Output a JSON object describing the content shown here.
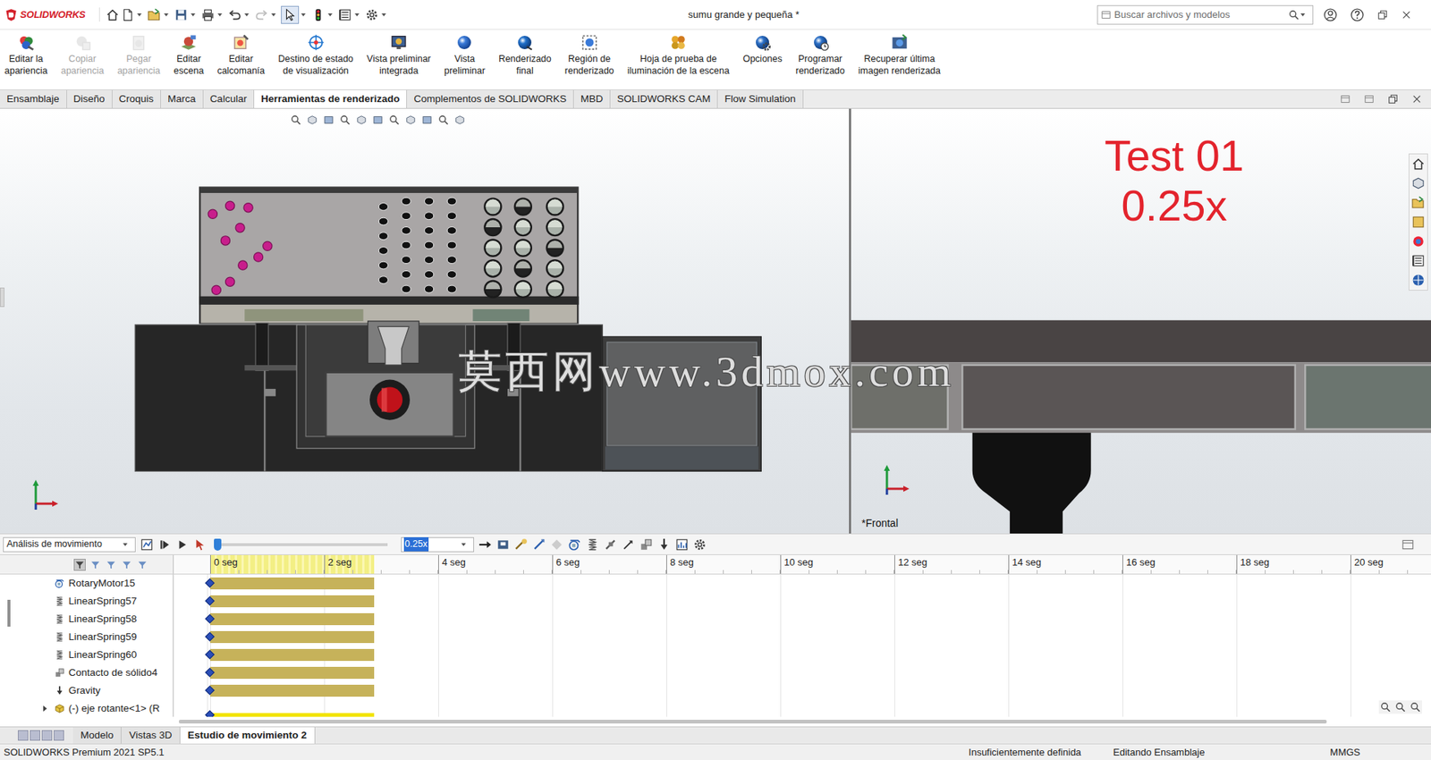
{
  "window": {
    "logo": "SOLIDWORKS",
    "title": "sumu grande y pequeña *",
    "select_tool_active": true
  },
  "search": {
    "placeholder": "Buscar archivos y modelos"
  },
  "ribbon": [
    {
      "lines": [
        "Editar la",
        "apariencia"
      ],
      "disabled": false
    },
    {
      "lines": [
        "Copiar",
        "apariencia"
      ],
      "disabled": true
    },
    {
      "lines": [
        "Pegar",
        "apariencia"
      ],
      "disabled": true
    },
    {
      "lines": [
        "Editar",
        "escena"
      ],
      "disabled": false
    },
    {
      "lines": [
        "Editar",
        "calcomanía"
      ],
      "disabled": false
    },
    {
      "lines": [
        "Destino de estado",
        "de visualización"
      ],
      "disabled": false
    },
    {
      "lines": [
        "Vista preliminar",
        "integrada"
      ],
      "disabled": false
    },
    {
      "lines": [
        "Vista",
        "preliminar"
      ],
      "disabled": false
    },
    {
      "lines": [
        "Renderizado",
        "final"
      ],
      "disabled": false
    },
    {
      "lines": [
        "Región de",
        "renderizado"
      ],
      "disabled": false
    },
    {
      "lines": [
        "Hoja de prueba de",
        "iluminación de la escena"
      ],
      "disabled": false
    },
    {
      "lines": [
        "Opciones"
      ],
      "disabled": false
    },
    {
      "lines": [
        "Programar",
        "renderizado"
      ],
      "disabled": false
    },
    {
      "lines": [
        "Recuperar última",
        "imagen renderizada"
      ],
      "disabled": false
    }
  ],
  "tabs": [
    {
      "label": "Ensamblaje",
      "selected": false
    },
    {
      "label": "Diseño",
      "selected": false
    },
    {
      "label": "Croquis",
      "selected": false
    },
    {
      "label": "Marca",
      "selected": false
    },
    {
      "label": "Calcular",
      "selected": false
    },
    {
      "label": "Herramientas de renderizado",
      "selected": true
    },
    {
      "label": "Complementos de SOLIDWORKS",
      "selected": false
    },
    {
      "label": "MBD",
      "selected": false
    },
    {
      "label": "SOLIDWORKS CAM",
      "selected": false
    },
    {
      "label": "Flow Simulation",
      "selected": false
    }
  ],
  "viewport": {
    "caption": [
      "Test 01",
      "0.25x"
    ],
    "view_name": "*Frontal",
    "watermark": "莫西网www.3dmox.com"
  },
  "motion": {
    "study_type": "Análisis de movimiento",
    "speed": "0.25x",
    "speed_selected": true,
    "playhead_level": 0,
    "seconds_per_tick": 2,
    "study_end_seconds": 2.88,
    "ticks": [
      "0 seg",
      "2 seg",
      "4 seg",
      "6 seg",
      "8 seg",
      "10 seg",
      "12 seg",
      "14 seg",
      "16 seg",
      "18 seg",
      "20 seg"
    ],
    "rows": [
      {
        "name": "RotaryMotor15",
        "kind": "motor",
        "end_seconds": 2.88
      },
      {
        "name": "LinearSpring57",
        "kind": "spring",
        "end_seconds": 2.88
      },
      {
        "name": "LinearSpring58",
        "kind": "spring",
        "end_seconds": 2.88
      },
      {
        "name": "LinearSpring59",
        "kind": "spring",
        "end_seconds": 2.88
      },
      {
        "name": "LinearSpring60",
        "kind": "spring",
        "end_seconds": 2.88
      },
      {
        "name": "Contacto de sólido4",
        "kind": "contact",
        "end_seconds": 2.88
      },
      {
        "name": "Gravity",
        "kind": "gravity",
        "end_seconds": 2.88
      },
      {
        "name": "(-) eje rotante<1> (R",
        "kind": "part",
        "end_seconds": 2.88
      }
    ]
  },
  "bottom_tabs": [
    {
      "label": "Modelo",
      "selected": false
    },
    {
      "label": "Vistas 3D",
      "selected": false
    },
    {
      "label": "Estudio de movimiento 2",
      "selected": true
    }
  ],
  "status_bar": {
    "product": "SOLIDWORKS Premium 2021 SP5.1",
    "definition": "Insuficientemente definida",
    "mode": "Editando Ensamblaje",
    "units": "MMGS"
  }
}
